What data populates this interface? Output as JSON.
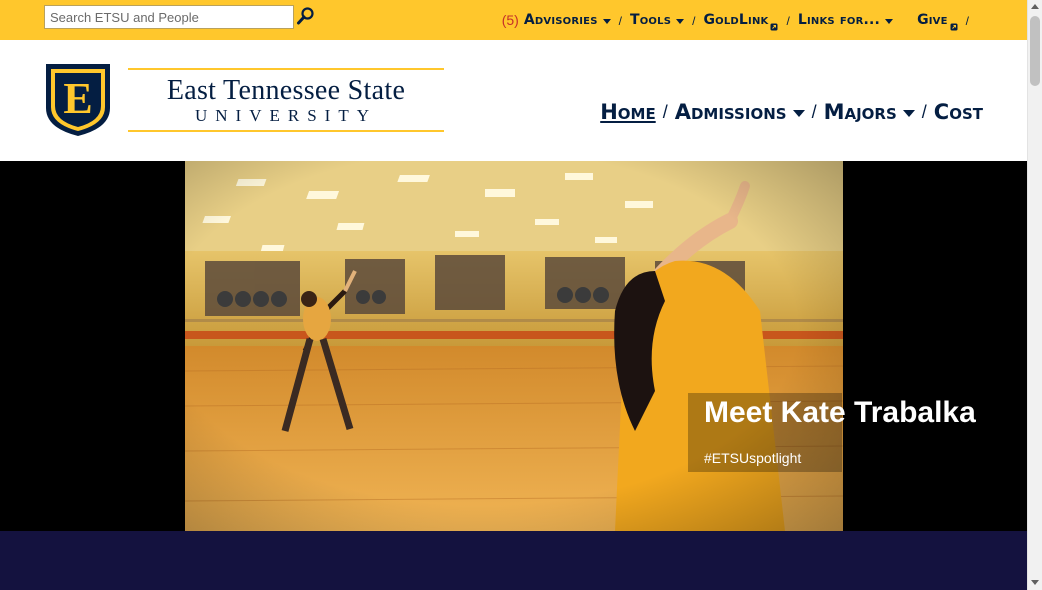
{
  "search": {
    "placeholder": "Search ETSU and People",
    "icon": "search-icon"
  },
  "utility_nav": {
    "advisories_count": "(5)",
    "items": [
      {
        "label": "Advisories",
        "dropdown": true
      },
      {
        "label": "Tools",
        "dropdown": true
      },
      {
        "label": "GoldLink",
        "external": true
      },
      {
        "label": "Links for...",
        "dropdown": true
      },
      {
        "label": "Give",
        "external": true
      }
    ],
    "separator": "/"
  },
  "logo": {
    "shield_letter": "E",
    "title": "East Tennessee State",
    "subtitle": "UNIVERSITY"
  },
  "main_nav": {
    "items": [
      {
        "label": "Home",
        "active": true,
        "dropdown": false
      },
      {
        "label": "Admissions",
        "dropdown": true
      },
      {
        "label": "Majors",
        "dropdown": true
      },
      {
        "label": "Cost",
        "dropdown": false
      }
    ],
    "separator": "/"
  },
  "hero": {
    "title": "Meet Kate Trabalka",
    "tag": "#ETSUspotlight"
  },
  "colors": {
    "gold": "#FFC72C",
    "navy": "#041E42",
    "band": "#14123F",
    "alert_red": "#C6302A"
  }
}
